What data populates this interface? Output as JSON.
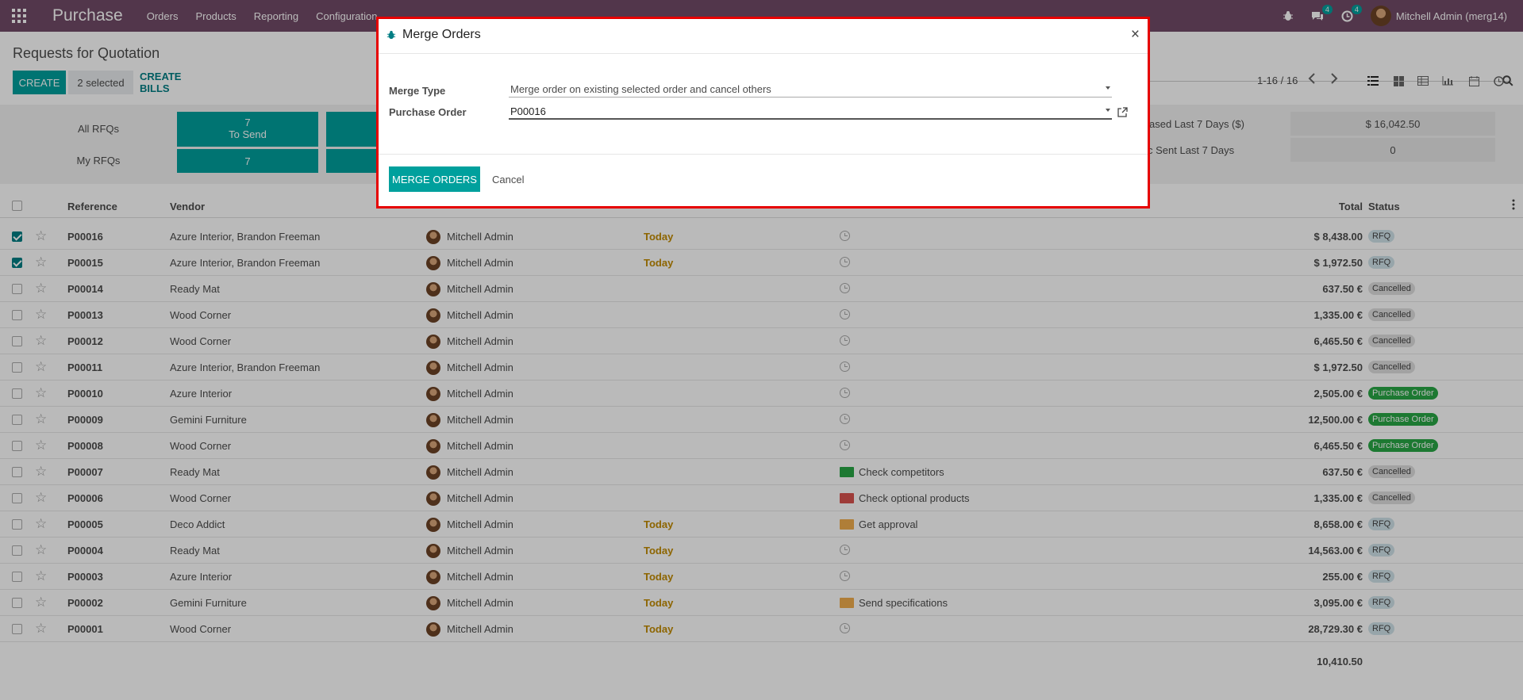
{
  "topnav": {
    "brand": "Purchase",
    "menu": [
      "Orders",
      "Products",
      "Reporting",
      "Configuration"
    ],
    "chat_count": "4",
    "activity_count": "4",
    "user_name": "Mitchell Admin (merg14)"
  },
  "control_panel": {
    "breadcrumb": "Requests for Quotation",
    "create_label": "CREATE",
    "selected_label": "2 selected",
    "bills_label": "CREATE BILLS",
    "pager": "1-16 / 16"
  },
  "dashboard": {
    "all_rfqs_label": "All RFQs",
    "my_rfqs_label": "My RFQs",
    "to_send_count": "7",
    "to_send_label": "To Send",
    "my_to_send_count": "7",
    "stat1_label": "ased Last 7 Days ($)",
    "stat1_value": "$ 16,042.50",
    "stat2_label": "c Sent Last 7 Days",
    "stat2_value": "0"
  },
  "table": {
    "headers": {
      "reference": "Reference",
      "vendor": "Vendor",
      "total": "Total",
      "status": "Status"
    },
    "rows": [
      {
        "ref": "P00016",
        "vendor": "Azure Interior, Brandon Freeman",
        "rep": "Mitchell Admin",
        "deadline": "Today",
        "activity": "",
        "activity_type": "none",
        "total": "$ 8,438.00",
        "status": "RFQ",
        "status_kind": "rfq",
        "checked": true
      },
      {
        "ref": "P00015",
        "vendor": "Azure Interior, Brandon Freeman",
        "rep": "Mitchell Admin",
        "deadline": "Today",
        "activity": "",
        "activity_type": "none",
        "total": "$ 1,972.50",
        "status": "RFQ",
        "status_kind": "rfq",
        "checked": true
      },
      {
        "ref": "P00014",
        "vendor": "Ready Mat",
        "rep": "Mitchell Admin",
        "deadline": "",
        "activity": "",
        "activity_type": "none",
        "total": "637.50 €",
        "status": "Cancelled",
        "status_kind": "cancelled",
        "checked": false
      },
      {
        "ref": "P00013",
        "vendor": "Wood Corner",
        "rep": "Mitchell Admin",
        "deadline": "",
        "activity": "",
        "activity_type": "none",
        "total": "1,335.00 €",
        "status": "Cancelled",
        "status_kind": "cancelled",
        "checked": false
      },
      {
        "ref": "P00012",
        "vendor": "Wood Corner",
        "rep": "Mitchell Admin",
        "deadline": "",
        "activity": "",
        "activity_type": "none",
        "total": "6,465.50 €",
        "status": "Cancelled",
        "status_kind": "cancelled",
        "checked": false
      },
      {
        "ref": "P00011",
        "vendor": "Azure Interior, Brandon Freeman",
        "rep": "Mitchell Admin",
        "deadline": "",
        "activity": "",
        "activity_type": "none",
        "total": "$ 1,972.50",
        "status": "Cancelled",
        "status_kind": "cancelled",
        "checked": false
      },
      {
        "ref": "P00010",
        "vendor": "Azure Interior",
        "rep": "Mitchell Admin",
        "deadline": "",
        "activity": "",
        "activity_type": "none",
        "total": "2,505.00 €",
        "status": "Purchase Order",
        "status_kind": "po",
        "checked": false
      },
      {
        "ref": "P00009",
        "vendor": "Gemini Furniture",
        "rep": "Mitchell Admin",
        "deadline": "",
        "activity": "",
        "activity_type": "none",
        "total": "12,500.00 €",
        "status": "Purchase Order",
        "status_kind": "po",
        "checked": false
      },
      {
        "ref": "P00008",
        "vendor": "Wood Corner",
        "rep": "Mitchell Admin",
        "deadline": "",
        "activity": "",
        "activity_type": "none",
        "total": "6,465.50 €",
        "status": "Purchase Order",
        "status_kind": "po",
        "checked": false
      },
      {
        "ref": "P00007",
        "vendor": "Ready Mat",
        "rep": "Mitchell Admin",
        "deadline": "",
        "activity": "Check competitors",
        "activity_type": "green",
        "total": "637.50 €",
        "status": "Cancelled",
        "status_kind": "cancelled",
        "checked": false
      },
      {
        "ref": "P00006",
        "vendor": "Wood Corner",
        "rep": "Mitchell Admin",
        "deadline": "",
        "activity": "Check optional products",
        "activity_type": "red",
        "total": "1,335.00 €",
        "status": "Cancelled",
        "status_kind": "cancelled",
        "checked": false
      },
      {
        "ref": "P00005",
        "vendor": "Deco Addict",
        "rep": "Mitchell Admin",
        "deadline": "Today",
        "activity": "Get approval",
        "activity_type": "orange",
        "total": "8,658.00 €",
        "status": "RFQ",
        "status_kind": "rfq",
        "checked": false
      },
      {
        "ref": "P00004",
        "vendor": "Ready Mat",
        "rep": "Mitchell Admin",
        "deadline": "Today",
        "activity": "",
        "activity_type": "none",
        "total": "14,563.00 €",
        "status": "RFQ",
        "status_kind": "rfq",
        "checked": false
      },
      {
        "ref": "P00003",
        "vendor": "Azure Interior",
        "rep": "Mitchell Admin",
        "deadline": "Today",
        "activity": "",
        "activity_type": "none",
        "total": "255.00 €",
        "status": "RFQ",
        "status_kind": "rfq",
        "checked": false
      },
      {
        "ref": "P00002",
        "vendor": "Gemini Furniture",
        "rep": "Mitchell Admin",
        "deadline": "Today",
        "activity": "Send specifications",
        "activity_type": "mail",
        "total": "3,095.00 €",
        "status": "RFQ",
        "status_kind": "rfq",
        "checked": false
      },
      {
        "ref": "P00001",
        "vendor": "Wood Corner",
        "rep": "Mitchell Admin",
        "deadline": "Today",
        "activity": "",
        "activity_type": "none",
        "total": "28,729.30 €",
        "status": "RFQ",
        "status_kind": "rfq",
        "checked": false
      }
    ],
    "grand_total": "10,410.50"
  },
  "modal": {
    "title": "Merge Orders",
    "merge_type_label": "Merge Type",
    "merge_type_value": "Merge order on existing selected order and cancel others",
    "po_label": "Purchase Order",
    "po_value": "P00016",
    "merge_button": "MERGE ORDERS",
    "cancel_button": "Cancel"
  },
  "colors": {
    "nav": "#714b67",
    "primary": "#00a09d",
    "highlight_border": "#e60000"
  }
}
